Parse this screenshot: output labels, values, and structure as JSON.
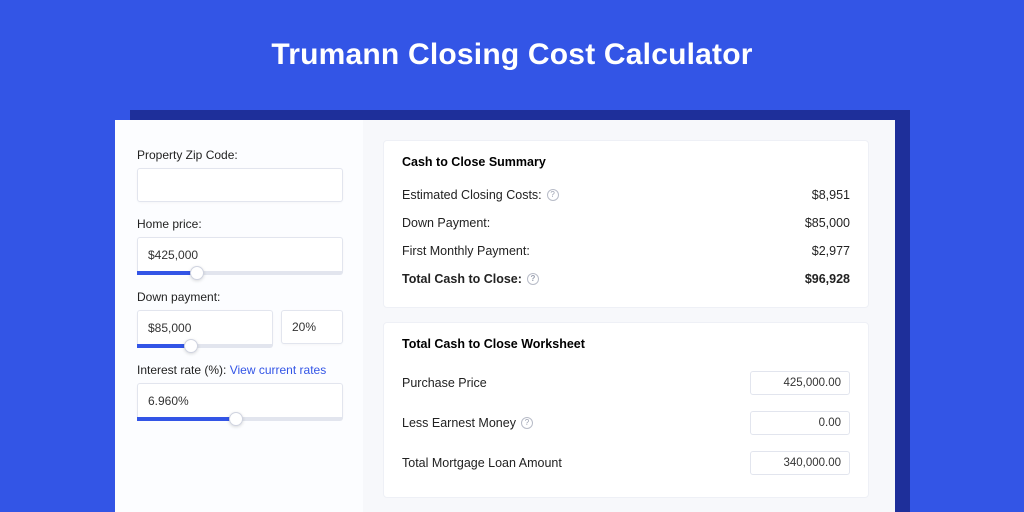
{
  "title": "Trumann Closing Cost Calculator",
  "form": {
    "zip": {
      "label": "Property Zip Code:",
      "value": ""
    },
    "price": {
      "label": "Home price:",
      "value": "$425,000",
      "slider_pct": 29
    },
    "down": {
      "label": "Down payment:",
      "value": "$85,000",
      "pct": "20%",
      "slider_pct": 40
    },
    "rate": {
      "label": "Interest rate (%):",
      "link": "View current rates",
      "value": "6.960%",
      "slider_pct": 48
    }
  },
  "summary": {
    "heading": "Cash to Close Summary",
    "rows": [
      {
        "label": "Estimated Closing Costs:",
        "help": true,
        "value": "$8,951"
      },
      {
        "label": "Down Payment:",
        "help": false,
        "value": "$85,000"
      },
      {
        "label": "First Monthly Payment:",
        "help": false,
        "value": "$2,977"
      }
    ],
    "total": {
      "label": "Total Cash to Close:",
      "help": true,
      "value": "$96,928"
    }
  },
  "worksheet": {
    "heading": "Total Cash to Close Worksheet",
    "rows": [
      {
        "label": "Purchase Price",
        "help": false,
        "value": "425,000.00"
      },
      {
        "label": "Less Earnest Money",
        "help": true,
        "value": "0.00"
      },
      {
        "label": "Total Mortgage Loan Amount",
        "help": false,
        "value": "340,000.00"
      }
    ]
  }
}
